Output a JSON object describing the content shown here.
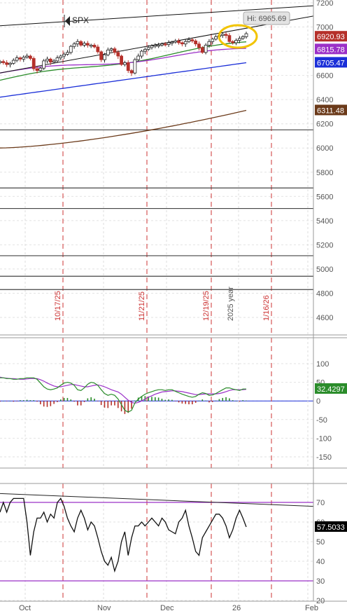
{
  "chart_data": [
    {
      "type": "candlestick",
      "title": "SPX",
      "ylim": [
        4420,
        7220
      ],
      "y_ticks": [
        4600,
        4800,
        5000,
        5200,
        5400,
        5600,
        5800,
        6000,
        6200,
        6400,
        6600,
        6800,
        7000,
        7200
      ],
      "x_month_labels": [
        "Oct",
        "Nov",
        "Dec",
        "26",
        "Feb"
      ],
      "date_markers": [
        "10/17/25",
        "11/21/25",
        "12/19/25",
        "1/16/26"
      ],
      "year_marker": "2025 year",
      "annotation": "Hi: 6965.69",
      "horizontal_levels": [
        6150,
        5670,
        5500,
        5110,
        4940,
        4830
      ],
      "moving_averages": [
        {
          "color": "#2a8c2a",
          "start": 6560,
          "end": 6870
        },
        {
          "color": "#9b30c8",
          "start": 6620,
          "end": 6816
        },
        {
          "color": "#1b2fd8",
          "start": 6420,
          "end": 6705
        },
        {
          "color": "#6b3a1a",
          "start": 6000,
          "end": 6311
        }
      ],
      "channel": {
        "upper_start": 7010,
        "upper_end": 7140,
        "lower_start": 6620,
        "lower_end": 6990
      },
      "closes": [
        6715,
        6705,
        6690,
        6700,
        6725,
        6745,
        6735,
        6750,
        6760,
        6740,
        6655,
        6640,
        6660,
        6720,
        6735,
        6710,
        6720,
        6745,
        6760,
        6775,
        6790,
        6840,
        6860,
        6880,
        6850,
        6865,
        6850,
        6850,
        6835,
        6795,
        6730,
        6770,
        6810,
        6820,
        6790,
        6760,
        6690,
        6705,
        6640,
        6620,
        6730,
        6760,
        6800,
        6815,
        6830,
        6845,
        6850,
        6850,
        6860,
        6855,
        6870,
        6875,
        6885,
        6870,
        6860,
        6880,
        6895,
        6885,
        6860,
        6830,
        6790,
        6850,
        6880,
        6900,
        6920,
        6930,
        6940,
        6930,
        6880,
        6870,
        6890,
        6905,
        6920,
        6945
      ],
      "badges": [
        {
          "label": "6920.93",
          "value": 6920.93,
          "color": "#b5302a"
        },
        {
          "label": "6815.78",
          "value": 6815.78,
          "color": "#9b30c8"
        },
        {
          "label": "6705.47",
          "value": 6705.47,
          "color": "#1b2fd8"
        },
        {
          "label": "6311.48",
          "value": 6311.48,
          "color": "#6b3a1a"
        }
      ]
    },
    {
      "type": "macd",
      "ylim": [
        -180,
        120
      ],
      "y_ticks": [
        100,
        50,
        0,
        -50,
        -100,
        -150
      ],
      "badge": {
        "label": "32.4297",
        "value": 32.4297,
        "color": "#2a8c2a"
      },
      "macd_values": [
        62,
        62,
        60,
        60,
        58,
        58,
        60,
        60,
        62,
        62,
        62,
        58,
        48,
        38,
        32,
        30,
        32,
        35,
        42,
        48,
        50,
        48,
        42,
        30,
        28,
        35,
        45,
        50,
        48,
        42,
        30,
        20,
        15,
        18,
        15,
        5,
        -10,
        -25,
        -30,
        -25,
        -5,
        5,
        12,
        18,
        22,
        25,
        28,
        30,
        30,
        28,
        30,
        30,
        26,
        22,
        18,
        15,
        12,
        10,
        12,
        18,
        22,
        20,
        15,
        16,
        20,
        25,
        30,
        35,
        35,
        32,
        30,
        28,
        32,
        32
      ],
      "signal_values": [
        64,
        62,
        61,
        60,
        60,
        59,
        58,
        58,
        59,
        60,
        60,
        60,
        57,
        53,
        48,
        44,
        40,
        38,
        38,
        40,
        42,
        44,
        44,
        42,
        40,
        38,
        38,
        40,
        42,
        43,
        41,
        38,
        34,
        30,
        27,
        24,
        18,
        10,
        2,
        -4,
        -6,
        -4,
        0,
        5,
        10,
        14,
        18,
        21,
        24,
        25,
        26,
        27,
        27,
        26,
        25,
        23,
        21,
        19,
        17,
        17,
        18,
        19,
        19,
        19,
        19,
        20,
        22,
        25,
        28,
        30,
        30,
        30,
        30,
        31
      ]
    },
    {
      "type": "line",
      "ylim": [
        20,
        80
      ],
      "y_ticks": [
        70,
        60,
        50,
        40,
        30,
        20
      ],
      "bands": [
        70,
        30
      ],
      "badge": {
        "label": "57.5033",
        "value": 57.5033,
        "color": "#000000"
      },
      "trendline": {
        "start": 74.5,
        "end": 68.0
      },
      "values": [
        65,
        70,
        65,
        70,
        72,
        72,
        72,
        72,
        60,
        43,
        55,
        62,
        62,
        65,
        60,
        64,
        62,
        70,
        72,
        68,
        62,
        58,
        55,
        62,
        66,
        62,
        56,
        60,
        58,
        52,
        45,
        40,
        38,
        42,
        35,
        40,
        50,
        55,
        43,
        52,
        58,
        58,
        60,
        58,
        60,
        62,
        60,
        58,
        62,
        60,
        56,
        55,
        54,
        60,
        62,
        66,
        58,
        52,
        45,
        43,
        52,
        55,
        58,
        61,
        64,
        64,
        62,
        58,
        52,
        56,
        62,
        66,
        62,
        57.5
      ]
    }
  ]
}
